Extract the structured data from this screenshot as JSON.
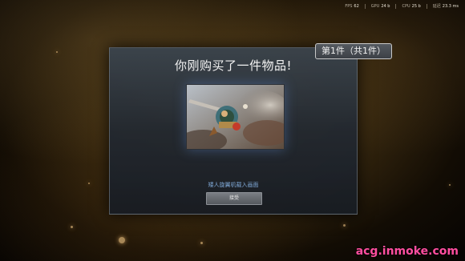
{
  "stats": {
    "fps_label": "FPS",
    "fps_value": "62",
    "gpu_label": "GPU",
    "gpu_value": "24 b",
    "cpu_label": "CPU",
    "cpu_value": "25 b",
    "ping_label": "延迟",
    "ping_value": "23.3 ms"
  },
  "counter": {
    "label": "第1件（共1件）"
  },
  "dialog": {
    "title": "你刚购买了一件物品!",
    "item_name": "矮人旋翼机载入画面",
    "accept_label": "接受"
  },
  "watermark": "acg.inmoke.com",
  "colors": {
    "accent_item_name": "#7fa8d6",
    "watermark": "#ff4ea0"
  }
}
